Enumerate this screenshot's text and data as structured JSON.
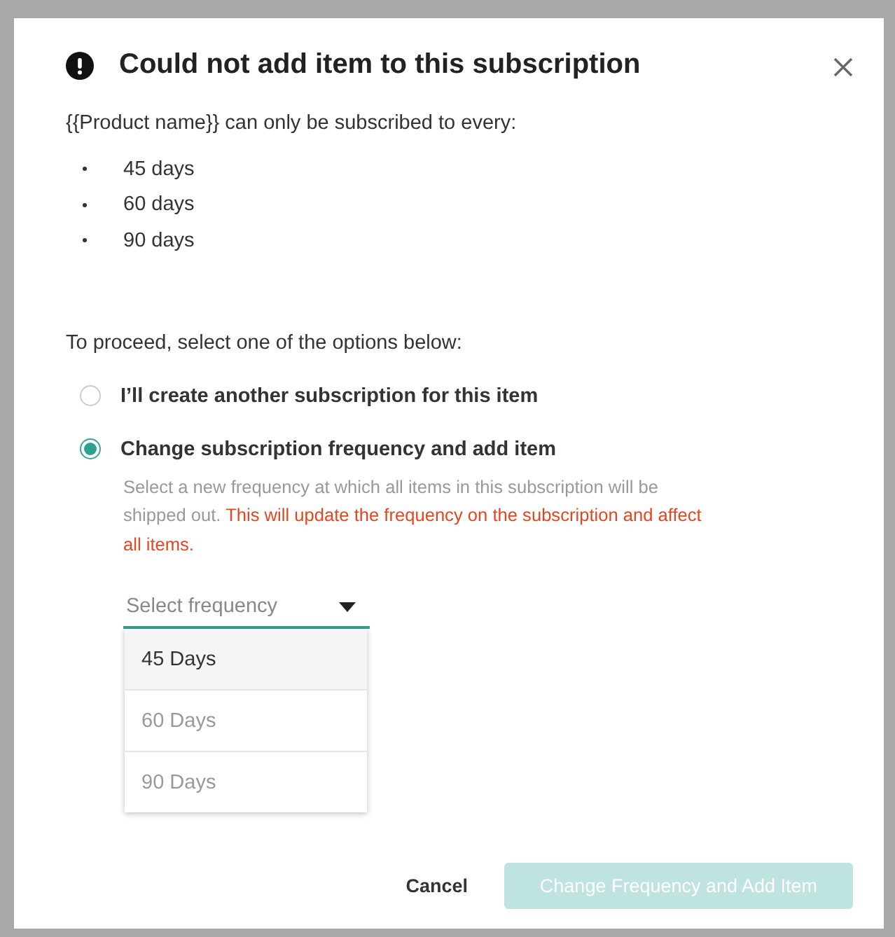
{
  "dialog": {
    "title": "Could not add item to this subscription",
    "intro": "{{Product name}} can only be subscribed to every:",
    "allowed_frequencies": [
      "45 days",
      "60 days",
      "90 days"
    ],
    "prompt": "To proceed, select one of the options below:",
    "options": [
      {
        "label": "I’ll create another subscription for this item",
        "selected": false
      },
      {
        "label": "Change subscription frequency and add item",
        "selected": true,
        "hint": "Select a new frequency at which all items in this subscription will be shipped out.",
        "warning": "This will update the frequency on the subscription and affect all items.",
        "select": {
          "placeholder": "Select frequency",
          "expanded": true,
          "items": [
            {
              "label": "45 Days",
              "selected": true
            },
            {
              "label": "60 Days",
              "selected": false
            },
            {
              "label": "90 Days",
              "selected": false
            }
          ]
        }
      }
    ],
    "buttons": [
      {
        "label": "Cancel",
        "kind": "text",
        "disabled": false
      },
      {
        "label": "Change Frequency and Add Item",
        "kind": "primary",
        "disabled": true
      }
    ]
  }
}
